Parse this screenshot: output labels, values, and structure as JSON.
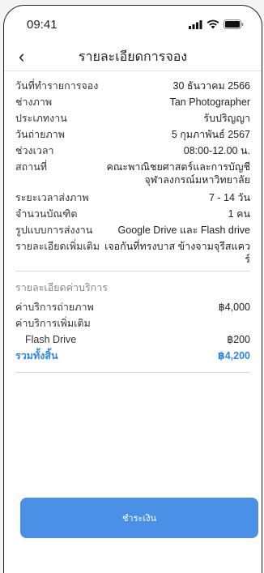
{
  "status_bar": {
    "time": "09:41"
  },
  "header": {
    "title": "รายละเอียดการจอง"
  },
  "details": [
    {
      "label": "วันที่ทำรายการจอง",
      "value": "30 ธันวาคม 2566"
    },
    {
      "label": "ช่างภาพ",
      "value": "Tan Photographer"
    },
    {
      "label": "ประเภทงาน",
      "value": "รับปริญญา"
    },
    {
      "label": "วันถ่ายภาพ",
      "value": "5 กุมภาพันธ์ 2567"
    },
    {
      "label": "ช่วงเวลา",
      "value": "08:00-12.00 น."
    },
    {
      "label": "สถานที่",
      "value_line1": "คณะพาณิชยศาสตร์และการบัญชี",
      "value_line2": "จุฬาลงกรณ์มหาวิทยาลัย"
    },
    {
      "label": "ระยะเวลาส่งภาพ",
      "value": "7 - 14 วัน"
    },
    {
      "label": "จำนวนบัณฑิต",
      "value": "1 คน"
    },
    {
      "label": "รูปแบบการส่งงาน",
      "value": "Google Drive และ Flash drive"
    },
    {
      "label": "รายละเอียดเพิ่มเติม",
      "value": "เจอกันที่ทรงบาส ข้างจามจุรีสแควร์"
    }
  ],
  "fees": {
    "section_title": "รายละเอียดค่าบริการ",
    "photo_label": "ค่าบริการถ่ายภาพ",
    "photo_value": "฿4,000",
    "extra_label": "ค่าบริการเพิ่มเติม",
    "extra_item_label": "Flash Drive",
    "extra_item_value": "฿200",
    "total_label": "รวมทั้งสิ้น",
    "total_value": "฿4,200"
  },
  "pay_button": {
    "label": "ชำระเงิน"
  },
  "colors": {
    "accent": "#2f86e8",
    "button": "#4a90e6"
  }
}
